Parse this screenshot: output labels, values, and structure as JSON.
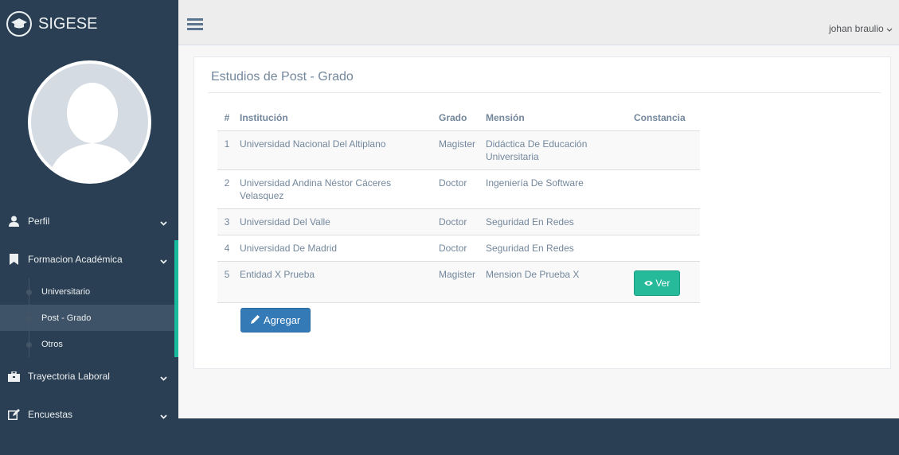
{
  "brand": {
    "title": "SIGESE"
  },
  "sidebar": {
    "items": [
      {
        "label": "Perfil"
      },
      {
        "label": "Formacion Académica"
      },
      {
        "label": "Trayectoria Laboral"
      },
      {
        "label": "Encuestas"
      }
    ],
    "children": [
      {
        "label": "Universitario"
      },
      {
        "label": "Post - Grado"
      },
      {
        "label": "Otros"
      }
    ]
  },
  "topnav": {
    "user": "johan braulio"
  },
  "panel": {
    "title": "Estudios de Post - Grado",
    "columns": [
      "#",
      "Institución",
      "Grado",
      "Mensión",
      "Constancia"
    ],
    "rows": [
      {
        "num": "1",
        "institucion": "Universidad Nacional Del Altiplano",
        "grado": "Magister",
        "mension": "Didáctica De Educación Universitaria",
        "constancia": ""
      },
      {
        "num": "2",
        "institucion": "Universidad Andina Néstor Cáceres Velasquez",
        "grado": "Doctor",
        "mension": "Ingeniería De Software",
        "constancia": ""
      },
      {
        "num": "3",
        "institucion": "Universidad Del Valle",
        "grado": "Doctor",
        "mension": "Seguridad En Redes",
        "constancia": ""
      },
      {
        "num": "4",
        "institucion": "Universidad De Madrid",
        "grado": "Doctor",
        "mension": "Seguridad En Redes",
        "constancia": ""
      },
      {
        "num": "5",
        "institucion": "Entidad X Prueba",
        "grado": "Magister",
        "mension": "Mension De Prueba X",
        "constancia": "Ver"
      }
    ],
    "add_label": "Agregar"
  },
  "colors": {
    "accent": "#1abb9c",
    "sidebar_bg": "#2a3f54",
    "primary": "#337ab7",
    "success": "#26b99a"
  }
}
